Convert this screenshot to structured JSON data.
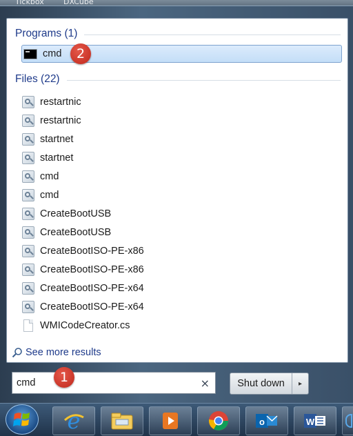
{
  "desktop_top": {
    "labels": [
      "Tickbox",
      "DXCube"
    ]
  },
  "start_menu": {
    "programs_header": "Programs (1)",
    "programs": [
      {
        "label": "cmd",
        "icon": "console-icon",
        "selected": true
      }
    ],
    "files_header": "Files (22)",
    "files": [
      {
        "label": "restartnic",
        "icon": "batch-file-icon"
      },
      {
        "label": "restartnic",
        "icon": "batch-file-icon"
      },
      {
        "label": "startnet",
        "icon": "batch-file-icon"
      },
      {
        "label": "startnet",
        "icon": "batch-file-icon"
      },
      {
        "label": "cmd",
        "icon": "batch-file-icon"
      },
      {
        "label": "cmd",
        "icon": "batch-file-icon"
      },
      {
        "label": "CreateBootUSB",
        "icon": "batch-file-icon"
      },
      {
        "label": "CreateBootUSB",
        "icon": "batch-file-icon"
      },
      {
        "label": "CreateBootISO-PE-x86",
        "icon": "batch-file-icon"
      },
      {
        "label": "CreateBootISO-PE-x86",
        "icon": "batch-file-icon"
      },
      {
        "label": "CreateBootISO-PE-x64",
        "icon": "batch-file-icon"
      },
      {
        "label": "CreateBootISO-PE-x64",
        "icon": "batch-file-icon"
      },
      {
        "label": "WMICodeCreator.cs",
        "icon": "text-file-icon"
      }
    ],
    "see_more": "See more results",
    "search": {
      "value": "cmd",
      "clear_glyph": "×"
    },
    "shutdown": {
      "label": "Shut down",
      "arrow": "▸"
    },
    "badges": {
      "first": "1",
      "second": "2"
    }
  },
  "taskbar": {
    "items": [
      "start-orb",
      "internet-explorer-icon",
      "file-explorer-icon",
      "media-app-icon",
      "chrome-icon",
      "outlook-icon",
      "word-icon"
    ]
  },
  "colors": {
    "accent": "#1e3a8a",
    "badge": "#d43a2c",
    "selection": "#cfe4fa"
  }
}
